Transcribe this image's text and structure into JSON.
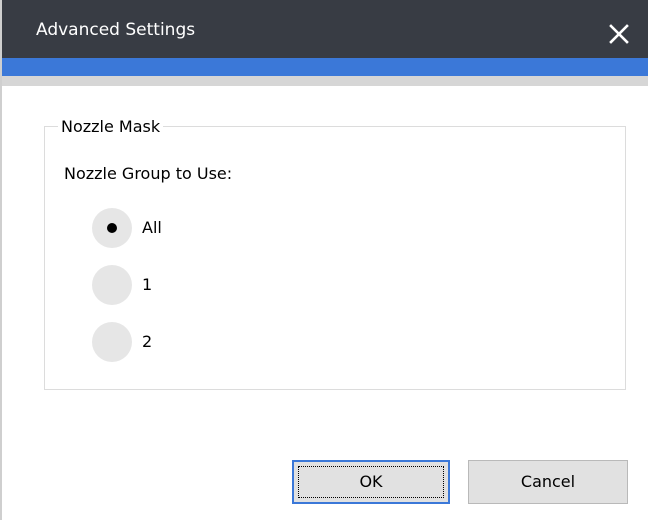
{
  "window": {
    "title": "Advanced Settings",
    "close_icon": "close-icon",
    "titlebar_color": "#383c44",
    "accent_color": "#3b78d8"
  },
  "nozzle_mask": {
    "legend": "Nozzle Mask",
    "group_label": "Nozzle Group to Use:",
    "selected": "All",
    "options": [
      {
        "label": "All",
        "checked": true
      },
      {
        "label": "1",
        "checked": false
      },
      {
        "label": "2",
        "checked": false
      }
    ]
  },
  "buttons": {
    "ok_label": "OK",
    "cancel_label": "Cancel"
  }
}
